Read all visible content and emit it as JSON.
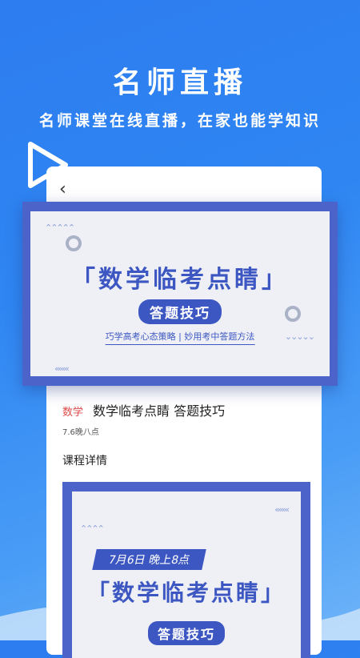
{
  "promo": {
    "headline": "名师直播",
    "subline": "名师课堂在线直播，在家也能学知识"
  },
  "icons": {
    "play": "play-icon",
    "back": "back-chevron-icon"
  },
  "banner": {
    "title": "「数学临考点睛」",
    "pill": "答题技巧",
    "strip": "巧学高考心态策略 | 妙用考中答题方法"
  },
  "course": {
    "subject_tag": "数学",
    "title": "数学临考点睛   答题技巧",
    "time": "7.6晚八点"
  },
  "detail": {
    "heading": "课程详情",
    "date_label": "7月6日 晚上8点",
    "title": "「数学临考点睛」",
    "pill": "答题技巧"
  },
  "colors": {
    "accent": "#3c57c2",
    "background": "#2f86f2",
    "tag": "#e04a4a"
  }
}
